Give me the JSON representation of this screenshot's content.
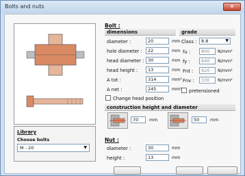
{
  "window": {
    "title": "Bolts and nuts"
  },
  "library": {
    "title": "Library",
    "choose_label": "Choose bolts",
    "selected": "M - 20"
  },
  "bolt": {
    "title": "Bolt :",
    "dimensions_header": "dimensions",
    "grade_header": "grade",
    "fields": [
      {
        "label": "diameter :",
        "value": "20",
        "unit": "mm"
      },
      {
        "label": "hole diameter :",
        "value": "22",
        "unit": "mm"
      },
      {
        "label": "head diameter :",
        "value": "30",
        "unit": "mm"
      },
      {
        "label": "head height :",
        "value": "13",
        "unit": "mm"
      },
      {
        "label": "A tot :",
        "value": "314",
        "unit": "mm²"
      },
      {
        "label": "A net :",
        "value": "245",
        "unit": "mm²"
      }
    ],
    "class_label": "Class :",
    "class_value": "8.8",
    "grade_fields": [
      {
        "label": "fu :",
        "value": "800",
        "unit": "N/mm²"
      },
      {
        "label": "fy :",
        "value": "640",
        "unit": "N/mm²"
      },
      {
        "label": "Fnt :",
        "value": "620",
        "unit": "N/mm²"
      },
      {
        "label": "Fnv :",
        "value": "330",
        "unit": "N/mm²"
      }
    ],
    "pretensioned_label": "pretensioned",
    "change_head_label": "Change head position"
  },
  "construction": {
    "header": "construction height and diameter",
    "height_value": "70",
    "height_unit": "mm",
    "diameter_value": "50",
    "diameter_unit": "mm"
  },
  "nut": {
    "title": "Nut :",
    "fields": [
      {
        "label": "diameter :",
        "value": "30",
        "unit": "mm"
      },
      {
        "label": "height :",
        "value": "13",
        "unit": "mm"
      }
    ]
  },
  "colors": {
    "title_bar": "#c8daee",
    "close_button": "#c94a35",
    "bolt_fill": "#d98a63",
    "input_border": "#7f9db9"
  }
}
